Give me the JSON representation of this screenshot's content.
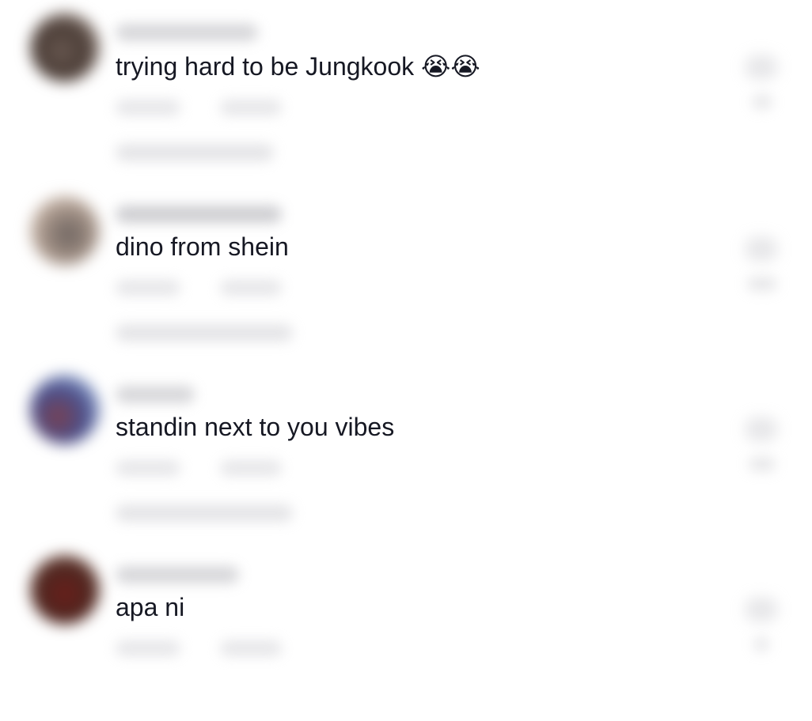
{
  "comments": [
    {
      "username": "",
      "text": "trying hard to be Jungkook 😭😭",
      "avatar_color": "#5b4a42",
      "avatar_highlight": "#c9b9ae"
    },
    {
      "username": "",
      "text": "dino from shein",
      "avatar_color": "#8b7a70",
      "avatar_highlight": "#d9c2b0"
    },
    {
      "username": "",
      "text": "standin next to you vibes",
      "avatar_color": "#4b4f8a",
      "avatar_highlight": "#9db8e0"
    },
    {
      "username": "",
      "text": "apa ni",
      "avatar_color": "#5a2a22",
      "avatar_highlight": "#8c5a4a"
    }
  ]
}
